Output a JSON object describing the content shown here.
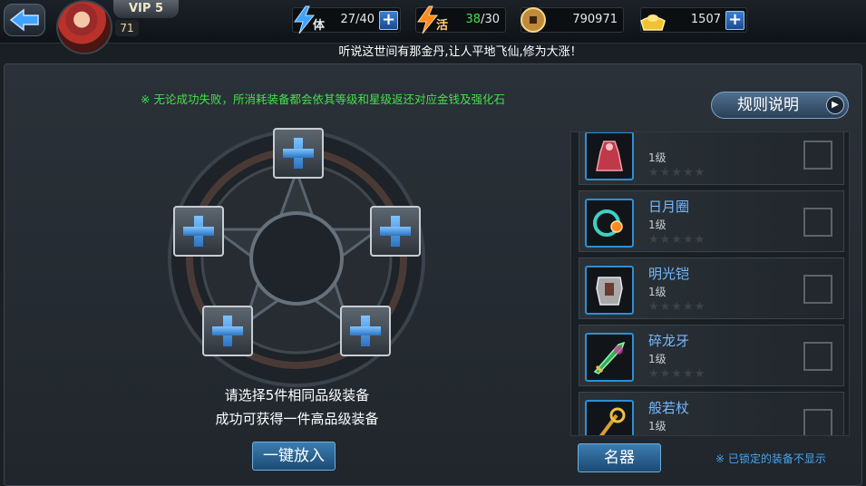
{
  "header": {
    "vip": "VIP 5",
    "level": "71",
    "stamina": {
      "label": "体",
      "current": "27",
      "max": "/40"
    },
    "vitality": {
      "label": "活",
      "current": "38",
      "max": "/30"
    },
    "coins": "790971",
    "gold": "1507"
  },
  "marquee": "听说这世间有那金丹,让人平地飞仙,修为大涨！",
  "notice": "※ 无论成功失败，所消耗装备都会依其等级和星级返还对应金钱及强化石",
  "rules_button": "规则说明",
  "hint_line1": "请选择5件相同品级装备",
  "hint_line2": "成功可获得一件高品级装备",
  "onekey_button": "一键放入",
  "category_button": "名器",
  "lock_note": "※ 已锁定的装备不显示",
  "items": [
    {
      "name": "",
      "level": "1级",
      "stars": "★★★★★",
      "icon": "robe-icon"
    },
    {
      "name": "日月圈",
      "level": "1级",
      "stars": "★★★★★",
      "icon": "ring-weapon-icon"
    },
    {
      "name": "明光铠",
      "level": "1级",
      "stars": "★★★★★",
      "icon": "armor-icon"
    },
    {
      "name": "碎龙牙",
      "level": "1级",
      "stars": "★★★★★",
      "icon": "dragon-blade-icon"
    },
    {
      "name": "般若杖",
      "level": "1级",
      "stars": "★★★★★",
      "icon": "staff-icon"
    }
  ],
  "colors": {
    "accent_green": "#44e04a",
    "item_name": "#76b9ff",
    "stamina_val": "#ffffff",
    "vitality_val": "#44e04a"
  }
}
